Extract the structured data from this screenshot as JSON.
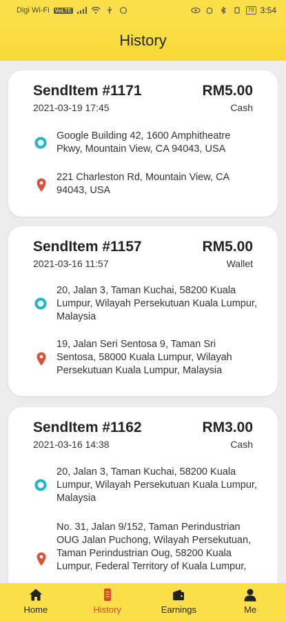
{
  "status_bar": {
    "carrier": "Digi Wi-Fi",
    "volte": "VoLTE",
    "battery": "79",
    "time": "3:54"
  },
  "app_bar": {
    "title": "History"
  },
  "orders": [
    {
      "id": "SendItem #1171",
      "date": "2021-03-19 17:45",
      "price": "RM5.00",
      "payment": "Cash",
      "pickup": "Google Building 42, 1600 Amphitheatre Pkwy, Mountain View, CA 94043, USA",
      "dropoff": "221 Charleston Rd, Mountain View, CA 94043, USA"
    },
    {
      "id": "SendItem #1157",
      "date": "2021-03-16 11:57",
      "price": "RM5.00",
      "payment": "Wallet",
      "pickup": "20, Jalan 3, Taman Kuchai, 58200 Kuala Lumpur, Wilayah Persekutuan Kuala Lumpur, Malaysia",
      "dropoff": "19, Jalan Seri Sentosa 9, Taman Sri Sentosa, 58000 Kuala Lumpur, Wilayah Persekutuan Kuala Lumpur, Malaysia"
    },
    {
      "id": "SendItem #1162",
      "date": "2021-03-16 14:38",
      "price": "RM3.00",
      "payment": "Cash",
      "pickup": "20, Jalan 3, Taman Kuchai, 58200 Kuala Lumpur, Wilayah Persekutuan Kuala Lumpur, Malaysia",
      "dropoff": "No. 31, Jalan 9/152, Taman Perindustrian OUG Jalan Puchong, Wilayah Persekutuan, Taman Perindustrian Oug, 58200 Kuala Lumpur, Federal Territory of Kuala Lumpur,"
    }
  ],
  "bottom_nav": [
    {
      "label": "Home",
      "icon": "home-icon"
    },
    {
      "label": "History",
      "icon": "history-icon",
      "active": true
    },
    {
      "label": "Earnings",
      "icon": "wallet-icon"
    },
    {
      "label": "Me",
      "icon": "person-icon"
    }
  ],
  "colors": {
    "accent": "#fbe04a",
    "active": "#e0492f",
    "pickup": "#1eb5c9",
    "dropoff": "#d9533b"
  }
}
